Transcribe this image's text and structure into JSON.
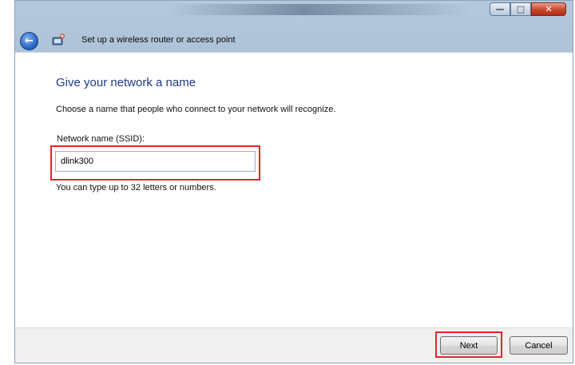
{
  "window": {
    "title": "Set up a wireless router or access point",
    "controls": {
      "minimize_icon": "minimize-icon",
      "maximize_icon": "maximize-icon",
      "close_icon": "close-icon"
    }
  },
  "page": {
    "heading": "Give your network a name",
    "description": "Choose a name that people who connect to your network will recognize.",
    "ssid_label": "Network name (SSID):",
    "ssid_value": "dlink300",
    "hint": "You can type up to 32 letters or numbers."
  },
  "footer": {
    "next_label": "Next",
    "cancel_label": "Cancel"
  },
  "colors": {
    "highlight": "#e0262c",
    "heading": "#1e3a87",
    "titlebar": "#9fb7cf"
  },
  "icons": [
    "back-arrow-icon",
    "network-setup-icon",
    "minimize-icon",
    "maximize-icon",
    "close-icon"
  ]
}
